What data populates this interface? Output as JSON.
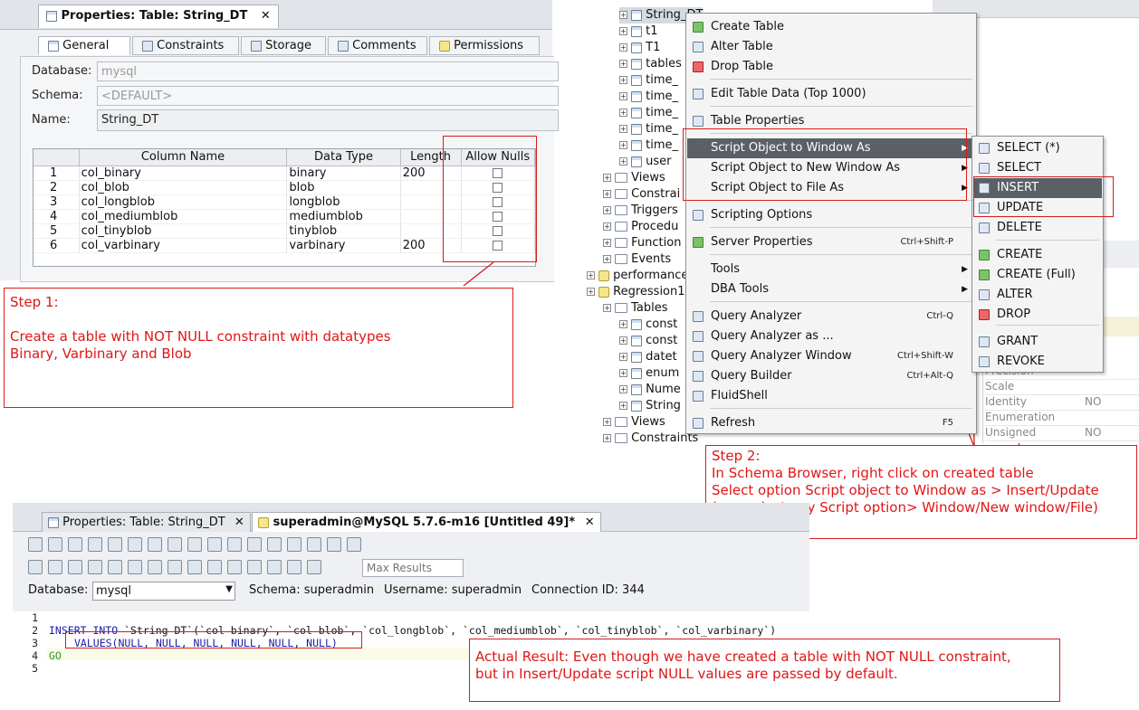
{
  "properties": {
    "tab_title": "Properties: Table: String_DT",
    "close": "✕",
    "subtabs": [
      "General",
      "Constraints",
      "Storage",
      "Comments",
      "Permissions"
    ],
    "database_label": "Database:",
    "database_value": "mysql",
    "schema_label": "Schema:",
    "schema_value": "<DEFAULT>",
    "name_label": "Name:",
    "name_value": "String_DT",
    "columns": {
      "headers": [
        "",
        "Column Name",
        "Data Type",
        "Length",
        "Allow Nulls"
      ],
      "rows": [
        {
          "n": "1",
          "name": "col_binary",
          "type": "binary",
          "length": "200"
        },
        {
          "n": "2",
          "name": "col_blob",
          "type": "blob",
          "length": ""
        },
        {
          "n": "3",
          "name": "col_longblob",
          "type": "longblob",
          "length": ""
        },
        {
          "n": "4",
          "name": "col_mediumblob",
          "type": "mediumblob",
          "length": ""
        },
        {
          "n": "5",
          "name": "col_tinyblob",
          "type": "tinyblob",
          "length": ""
        },
        {
          "n": "6",
          "name": "col_varbinary",
          "type": "varbinary",
          "length": "200"
        }
      ]
    }
  },
  "notes": {
    "step1": "Step 1:\n\nCreate a table with NOT NULL constraint with datatypes\nBinary, Varbinary and Blob",
    "step2": "Step 2:\nIn Schema Browser, right click on created table\nSelect option Script object to Window as > Insert/Update\n(can select any Script option> Window/New window/File)",
    "actual": "Actual Result: Even though we have created a table with NOT NULL constraint,\nbut in Insert/Update script NULL values are passed by default."
  },
  "tree": {
    "items_top": [
      "String_DT",
      "t1",
      "T1",
      "tables",
      "time_",
      "time_",
      "time_",
      "time_",
      "time_",
      "user"
    ],
    "views": "Views",
    "constraints": "Constrai",
    "triggers": "Triggers",
    "procedures": "Procedu",
    "functions": "Function",
    "events": "Events",
    "performance": "performance",
    "regression": "Regression1",
    "tables": "Tables",
    "sub_items": [
      "const",
      "const",
      "datet",
      "enum",
      "Nume",
      "String"
    ],
    "views2": "Views",
    "constraints2": "Constraints"
  },
  "context_menu": {
    "items": [
      {
        "label": "Create Table",
        "icon": "create-table-icon"
      },
      {
        "label": "Alter Table",
        "icon": "alter-table-icon"
      },
      {
        "label": "Drop Table",
        "icon": "drop-table-icon"
      },
      {
        "label": "Edit Table Data (Top 1000)",
        "icon": "edit-data-icon"
      },
      {
        "label": "Table Properties",
        "icon": "properties-icon"
      },
      {
        "label": "Script Object to Window As",
        "icon": ""
      },
      {
        "label": "Script Object to New Window As",
        "icon": ""
      },
      {
        "label": "Script Object to File As",
        "icon": ""
      },
      {
        "label": "Scripting Options",
        "icon": "scripting-options-icon"
      },
      {
        "label": "Server Properties",
        "icon": "server-properties-icon",
        "shortcut": "Ctrl+Shift-P"
      },
      {
        "label": "Tools",
        "icon": ""
      },
      {
        "label": "DBA Tools",
        "icon": ""
      },
      {
        "label": "Query Analyzer",
        "icon": "query-analyzer-icon",
        "shortcut": "Ctrl-Q"
      },
      {
        "label": "Query Analyzer as ...",
        "icon": "query-analyzer-as-icon"
      },
      {
        "label": "Query Analyzer Window",
        "icon": "query-window-icon",
        "shortcut": "Ctrl+Shift-W"
      },
      {
        "label": "Query Builder",
        "icon": "query-builder-icon",
        "shortcut": "Ctrl+Alt-Q"
      },
      {
        "label": "FluidShell",
        "icon": "fluidshell-icon"
      },
      {
        "label": "Refresh",
        "icon": "refresh-icon",
        "shortcut": "F5"
      }
    ]
  },
  "submenu": {
    "items": [
      "SELECT (*)",
      "SELECT",
      "INSERT",
      "UPDATE",
      "DELETE",
      "CREATE",
      "CREATE (Full)",
      "ALTER",
      "DROP",
      "GRANT",
      "REVOKE"
    ]
  },
  "props_pane": {
    "rows": [
      {
        "k": "Precision",
        "v": ""
      },
      {
        "k": "Scale",
        "v": ""
      },
      {
        "k": "Identity",
        "v": "NO"
      },
      {
        "k": "Enumeration",
        "v": ""
      },
      {
        "k": "Unsigned",
        "v": "NO"
      }
    ]
  },
  "editor": {
    "tab1": "Properties: Table: String_DT",
    "tab2": "superadmin@MySQL 5.7.6-m16 [Untitled 49]*",
    "max_results_placeholder": "Max Results",
    "database_label": "Database:",
    "database_value": "mysql",
    "schema": "Schema:  superadmin",
    "username": "Username:  superadmin",
    "connection": "Connection ID:  344",
    "line_numbers": [
      "1",
      "2",
      "3",
      "4",
      "5"
    ],
    "line2_kw": "INSERT INTO",
    "line2_rest": " `String DT`(`col binary`, `col blob`, `col_longblob`, `col_mediumblob`, `col_tinyblob`, `col_varbinary`)",
    "line3": "VALUES(NULL, NULL, NULL, NULL, NULL, NULL)",
    "line4": "GO"
  }
}
